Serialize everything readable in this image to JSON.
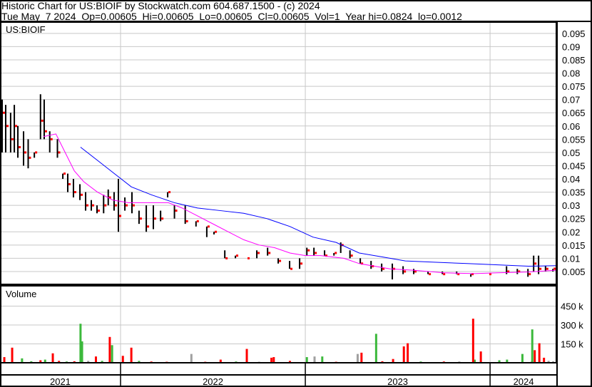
{
  "header": {
    "title": "Historic Chart for US:BIOIF by Stockwatch.com 604.687.1500 - (c) 2024",
    "quote": "Tue May  7 2024  Op=0.00605  Hi=0.00605  Lo=0.00605  Cl=0.00605  Vol=1  Year hi=0.0824  lo=0.0012"
  },
  "colors": {
    "bar": "#000000",
    "close": "#ff0000",
    "ma_long": "#0000ff",
    "ma_short": "#ff00ff",
    "vol_up": "#3cb93c",
    "vol_down": "#ff0000",
    "vol_flat": "#a0a0a0",
    "grid": "#c8c8c8"
  },
  "chart_data": [
    {
      "type": "line",
      "title": "US:BIOIF",
      "x_units": "months since Jan 2021",
      "xlim": [
        4.17,
        40.35
      ],
      "ylim": [
        0,
        0.0985
      ],
      "y_ticks": [
        "0.005",
        "0.01",
        "0.015",
        "0.02",
        "0.025",
        "0.03",
        "0.035",
        "0.04",
        "0.045",
        "0.05",
        "0.055",
        "0.06",
        "0.065",
        "0.07",
        "0.075",
        "0.08",
        "0.085",
        "0.09",
        "0.095"
      ],
      "x_ticks": [
        {
          "label": "2021",
          "start": 0
        },
        {
          "label": "2022",
          "start": 12
        },
        {
          "label": "2023",
          "start": 24
        },
        {
          "label": "2024",
          "start": 36
        }
      ],
      "ohlc": [
        [
          4.31,
          0.07,
          0.05,
          0.065
        ],
        [
          4.54,
          0.068,
          0.05,
          0.06
        ],
        [
          4.86,
          0.065,
          0.05,
          0.055
        ],
        [
          5.1,
          0.068,
          0.05,
          0.06
        ],
        [
          5.33,
          0.06,
          0.048,
          0.052
        ],
        [
          5.7,
          0.058,
          0.045,
          0.05
        ],
        [
          6.0,
          0.055,
          0.044,
          0.048
        ],
        [
          6.4,
          0.05,
          0.048,
          0.05
        ],
        [
          6.8,
          0.072,
          0.055,
          0.062
        ],
        [
          7.04,
          0.07,
          0.055,
          0.058
        ],
        [
          7.4,
          0.058,
          0.05,
          0.055
        ],
        [
          7.9,
          0.055,
          0.048,
          0.05
        ],
        [
          8.25,
          0.042,
          0.04,
          0.042
        ],
        [
          8.57,
          0.042,
          0.035,
          0.038
        ],
        [
          8.94,
          0.04,
          0.033,
          0.035
        ],
        [
          9.36,
          0.038,
          0.032,
          0.034
        ],
        [
          9.73,
          0.035,
          0.028,
          0.03
        ],
        [
          10.1,
          0.032,
          0.028,
          0.03
        ],
        [
          10.47,
          0.03,
          0.027,
          0.028
        ],
        [
          10.9,
          0.034,
          0.027,
          0.03
        ],
        [
          11.2,
          0.036,
          0.03,
          0.033
        ],
        [
          11.58,
          0.035,
          0.028,
          0.03
        ],
        [
          11.86,
          0.04,
          0.02,
          0.026
        ],
        [
          12.28,
          0.033,
          0.028,
          0.03
        ],
        [
          12.74,
          0.035,
          0.027,
          0.03
        ],
        [
          13.2,
          0.028,
          0.023,
          0.025
        ],
        [
          13.67,
          0.03,
          0.02,
          0.022
        ],
        [
          14.13,
          0.03,
          0.021,
          0.025
        ],
        [
          14.6,
          0.028,
          0.024,
          0.025
        ],
        [
          15.06,
          0.035,
          0.033,
          0.035
        ],
        [
          15.5,
          0.03,
          0.025,
          0.028
        ],
        [
          16.2,
          0.03,
          0.023,
          0.024
        ],
        [
          16.9,
          0.024,
          0.022,
          0.024
        ],
        [
          17.6,
          0.022,
          0.018,
          0.022
        ],
        [
          18.07,
          0.02,
          0.019,
          0.02
        ],
        [
          18.77,
          0.013,
          0.01,
          0.01
        ],
        [
          19.46,
          0.011,
          0.01,
          0.011
        ],
        [
          20.2,
          0.01,
          0.01,
          0.01
        ],
        [
          20.85,
          0.013,
          0.01,
          0.012
        ],
        [
          21.55,
          0.014,
          0.011,
          0.012
        ],
        [
          22.24,
          0.01,
          0.008,
          0.009
        ],
        [
          22.98,
          0.009,
          0.006,
          0.006
        ],
        [
          23.63,
          0.01,
          0.006,
          0.008
        ],
        [
          24.1,
          0.014,
          0.011,
          0.013
        ],
        [
          24.56,
          0.014,
          0.011,
          0.012
        ],
        [
          25.25,
          0.013,
          0.011,
          0.011
        ],
        [
          25.86,
          0.012,
          0.011,
          0.012
        ],
        [
          26.3,
          0.016,
          0.012,
          0.015
        ],
        [
          26.9,
          0.013,
          0.01,
          0.011
        ],
        [
          27.57,
          0.01,
          0.008,
          0.008
        ],
        [
          28.27,
          0.009,
          0.006,
          0.007
        ],
        [
          28.96,
          0.008,
          0.005,
          0.006
        ],
        [
          29.65,
          0.008,
          0.002,
          0.006
        ],
        [
          30.35,
          0.007,
          0.004,
          0.005
        ],
        [
          31.04,
          0.006,
          0.004,
          0.005
        ],
        [
          31.97,
          0.005,
          0.004,
          0.004
        ],
        [
          32.9,
          0.005,
          0.004,
          0.004
        ],
        [
          33.83,
          0.005,
          0.004,
          0.004
        ],
        [
          34.75,
          0.004,
          0.003,
          0.004
        ],
        [
          35.9,
          0.004,
          0.004,
          0.004
        ],
        [
          37.07,
          0.007,
          0.004,
          0.005
        ],
        [
          37.77,
          0.006,
          0.004,
          0.005
        ],
        [
          38.46,
          0.006,
          0.003,
          0.004
        ],
        [
          38.83,
          0.011,
          0.005,
          0.008
        ],
        [
          39.15,
          0.011,
          0.004,
          0.006
        ],
        [
          39.6,
          0.007,
          0.005,
          0.006
        ],
        [
          40.08,
          0.006,
          0.005,
          0.00605
        ]
      ],
      "series": [
        {
          "name": "long moving average",
          "color_key": "ma_long",
          "points": [
            [
              9.4,
              0.052
            ],
            [
              10.5,
              0.047
            ],
            [
              11.6,
              0.042
            ],
            [
              12.7,
              0.037
            ],
            [
              14.0,
              0.034
            ],
            [
              15.5,
              0.031
            ],
            [
              17.0,
              0.029
            ],
            [
              18.5,
              0.028
            ],
            [
              20.0,
              0.027
            ],
            [
              21.5,
              0.025
            ],
            [
              23.0,
              0.022
            ],
            [
              24.5,
              0.018
            ],
            [
              26.0,
              0.016
            ],
            [
              27.5,
              0.012
            ],
            [
              29.0,
              0.0105
            ],
            [
              30.5,
              0.009
            ],
            [
              32.5,
              0.0085
            ],
            [
              34.5,
              0.008
            ],
            [
              36.5,
              0.0075
            ],
            [
              38.5,
              0.007
            ],
            [
              40.3,
              0.0072
            ]
          ]
        },
        {
          "name": "short moving average",
          "color_key": "ma_short",
          "points": [
            [
              7.0,
              0.056
            ],
            [
              7.8,
              0.057
            ],
            [
              8.4,
              0.05
            ],
            [
              9.0,
              0.043
            ],
            [
              9.6,
              0.039
            ],
            [
              10.5,
              0.035
            ],
            [
              11.5,
              0.032
            ],
            [
              12.5,
              0.031
            ],
            [
              14.0,
              0.031
            ],
            [
              15.1,
              0.031
            ],
            [
              16.0,
              0.029
            ],
            [
              17.0,
              0.026
            ],
            [
              18.0,
              0.023
            ],
            [
              19.0,
              0.02
            ],
            [
              20.0,
              0.017
            ],
            [
              21.0,
              0.015
            ],
            [
              22.0,
              0.014
            ],
            [
              23.0,
              0.012
            ],
            [
              24.0,
              0.011
            ],
            [
              25.0,
              0.011
            ],
            [
              26.5,
              0.01
            ],
            [
              27.5,
              0.008
            ],
            [
              28.5,
              0.007
            ],
            [
              29.5,
              0.006
            ],
            [
              31.0,
              0.0055
            ],
            [
              33.0,
              0.0045
            ],
            [
              35.0,
              0.0042
            ],
            [
              36.5,
              0.0045
            ],
            [
              38.5,
              0.0048
            ],
            [
              40.3,
              0.0055
            ]
          ]
        }
      ]
    },
    {
      "type": "bar",
      "title": "Volume",
      "x_units": "months since Jan 2021",
      "ylim": [
        0,
        480000
      ],
      "y_ticks": [
        {
          "label": "150 k",
          "value": 150000
        },
        {
          "label": "300 k",
          "value": 300000
        },
        {
          "label": "450 k",
          "value": 450000
        }
      ],
      "bars": [
        [
          4.45,
          45000,
          "down"
        ],
        [
          4.96,
          120000,
          "down"
        ],
        [
          5.6,
          35000,
          "up"
        ],
        [
          6.2,
          12000,
          "up"
        ],
        [
          6.8,
          20000,
          "down"
        ],
        [
          7.1,
          25000,
          "up"
        ],
        [
          7.6,
          75000,
          "down"
        ],
        [
          8.0,
          15000,
          "down"
        ],
        [
          8.5,
          10000,
          "up"
        ],
        [
          9.0,
          12000,
          "down"
        ],
        [
          9.4,
          310000,
          "up"
        ],
        [
          9.5,
          170000,
          "up"
        ],
        [
          9.9,
          15000,
          "flat"
        ],
        [
          10.4,
          50000,
          "down"
        ],
        [
          10.8,
          15000,
          "up"
        ],
        [
          11.3,
          205000,
          "down"
        ],
        [
          11.45,
          140000,
          "up"
        ],
        [
          12.15,
          55000,
          "down"
        ],
        [
          12.7,
          120000,
          "down"
        ],
        [
          13.2,
          15000,
          "up"
        ],
        [
          14.0,
          10000,
          "down"
        ],
        [
          15.0,
          8000,
          "down"
        ],
        [
          16.6,
          70000,
          "flat"
        ],
        [
          17.5,
          8000,
          "down"
        ],
        [
          18.5,
          25000,
          "down"
        ],
        [
          19.5,
          10000,
          "up"
        ],
        [
          20.2,
          110000,
          "down"
        ],
        [
          21.0,
          8000,
          "flat"
        ],
        [
          21.8,
          40000,
          "down"
        ],
        [
          21.95,
          45000,
          "down"
        ],
        [
          23.0,
          15000,
          "down"
        ],
        [
          24.1,
          45000,
          "up"
        ],
        [
          24.6,
          50000,
          "flat"
        ],
        [
          25.1,
          50000,
          "up"
        ],
        [
          26.0,
          8000,
          "down"
        ],
        [
          27.4,
          70000,
          "flat"
        ],
        [
          27.65,
          80000,
          "down"
        ],
        [
          28.6,
          230000,
          "up"
        ],
        [
          29.0,
          12000,
          "down"
        ],
        [
          29.7,
          30000,
          "down"
        ],
        [
          30.4,
          130000,
          "down"
        ],
        [
          30.65,
          155000,
          "down"
        ],
        [
          31.5,
          10000,
          "up"
        ],
        [
          33.0,
          10000,
          "down"
        ],
        [
          34.0,
          10000,
          "flat"
        ],
        [
          35.0,
          25000,
          "up"
        ],
        [
          34.9,
          350000,
          "down"
        ],
        [
          35.4,
          90000,
          "down"
        ],
        [
          36.6,
          20000,
          "up"
        ],
        [
          37.1,
          25000,
          "up"
        ],
        [
          38.1,
          70000,
          "up"
        ],
        [
          38.7,
          10000,
          "flat"
        ],
        [
          38.74,
          265000,
          "up"
        ],
        [
          38.9,
          100000,
          "down"
        ],
        [
          39.2,
          155000,
          "down"
        ],
        [
          39.5,
          40000,
          "down"
        ],
        [
          39.8,
          15000,
          "flat"
        ],
        [
          40.1,
          12000,
          "flat"
        ]
      ]
    }
  ]
}
